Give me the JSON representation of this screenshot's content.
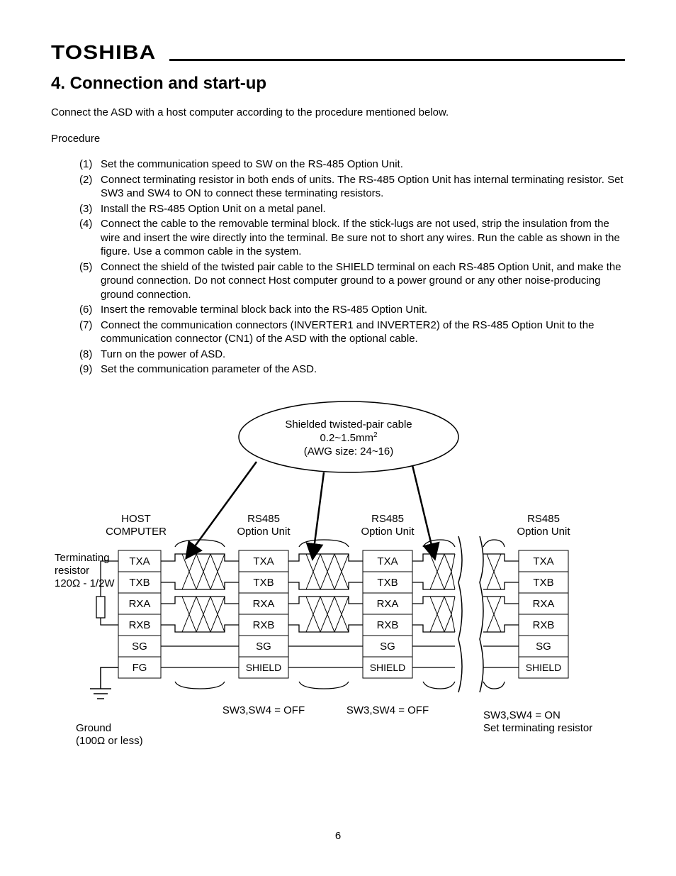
{
  "brand": "TOSHIBA",
  "section_title": "4. Connection and start-up",
  "intro": "Connect the ASD with a host computer according to the procedure mentioned below.",
  "procedure_label": "Procedure",
  "steps": [
    {
      "n": "(1)",
      "t": "Set the communication speed to SW on the RS-485 Option Unit."
    },
    {
      "n": "(2)",
      "t": "Connect terminating resistor in both ends of units. The RS-485 Option Unit has internal terminating resistor. Set SW3 and SW4 to ON to connect these terminating resistors."
    },
    {
      "n": "(3)",
      "t": "Install the RS-485 Option Unit on a metal panel."
    },
    {
      "n": "(4)",
      "t": "Connect the cable to the removable terminal block. If the stick-lugs are not used, strip the insulation from the wire and insert the wire directly into the terminal. Be sure not to short any wires. Run the cable as shown in the figure. Use a common cable in the system."
    },
    {
      "n": "(5)",
      "t": "Connect the shield of the twisted pair cable to the SHIELD terminal on each RS-485 Option Unit, and make the ground connection. Do not connect Host computer ground to a power ground or any other noise-producing ground connection."
    },
    {
      "n": "(6)",
      "t": "Insert the removable terminal block back into the RS-485 Option Unit."
    },
    {
      "n": "(7)",
      "t": "Connect the communication connectors (INVERTER1 and INVERTER2) of the RS-485 Option Unit to the communication connector (CN1) of the ASD with the optional cable."
    },
    {
      "n": "(8)",
      "t": "Turn on the power of ASD."
    },
    {
      "n": "(9)",
      "t": "Set the communication parameter of the ASD."
    }
  ],
  "diagram": {
    "callout_l1": "Shielded twisted-pair cable",
    "callout_l2": "0.2~1.5mm",
    "callout_sup": "2",
    "callout_l3": "(AWG size: 24~16)",
    "host_l1": "HOST",
    "host_l2": "COMPUTER",
    "unit_l1": "RS485",
    "unit_l2": "Option Unit",
    "term_l1": "Terminating",
    "term_l2": "resistor",
    "term_l3": "120Ω - 1/2W",
    "ground_l1": "Ground",
    "ground_l2": "(100Ω or less)",
    "pins_host": [
      "TXA",
      "TXB",
      "RXA",
      "RXB",
      "SG",
      "FG"
    ],
    "pins_unit": [
      "TXA",
      "TXB",
      "RXA",
      "RXB",
      "SG",
      "SHIELD"
    ],
    "sw_off": "SW3,SW4 = OFF",
    "sw_on_l1": "SW3,SW4 = ON",
    "sw_on_l2": "Set terminating resistor"
  },
  "page_number": "6"
}
